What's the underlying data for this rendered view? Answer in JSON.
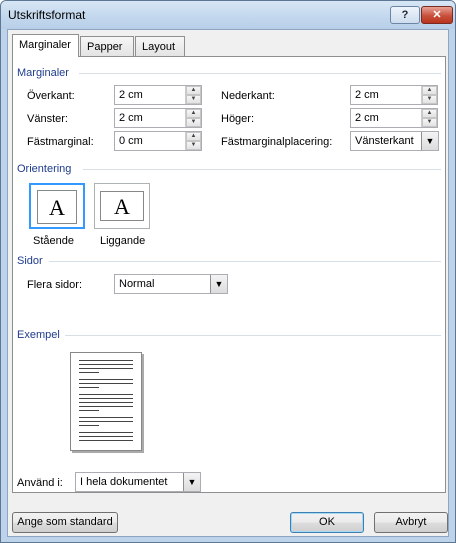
{
  "window": {
    "title": "Utskriftsformat",
    "help_label": "?",
    "close_label": "✕"
  },
  "tabs": [
    {
      "label": "Marginaler",
      "active": true
    },
    {
      "label": "Papper",
      "active": false
    },
    {
      "label": "Layout",
      "active": false
    }
  ],
  "margins": {
    "section": "Marginaler",
    "top_label": "Överkant:",
    "top_value": "2 cm",
    "left_label": "Vänster:",
    "left_value": "2 cm",
    "gutter_label": "Fästmarginal:",
    "gutter_value": "0 cm",
    "bottom_label": "Nederkant:",
    "bottom_value": "2 cm",
    "right_label": "Höger:",
    "right_value": "2 cm",
    "gutter_pos_label": "Fästmarginalplacering:",
    "gutter_pos_value": "Vänsterkant"
  },
  "orientation": {
    "section": "Orientering",
    "icon_glyph": "A",
    "portrait_label": "Stående",
    "landscape_label": "Liggande",
    "selected": "portrait"
  },
  "pages": {
    "section": "Sidor",
    "multiple_label": "Flera sidor:",
    "multiple_value": "Normal"
  },
  "preview": {
    "section": "Exempel"
  },
  "apply": {
    "label": "Använd i:",
    "value": "I hela dokumentet"
  },
  "buttons": {
    "default_label": "Ange som standard",
    "ok_label": "OK",
    "cancel_label": "Avbryt"
  }
}
